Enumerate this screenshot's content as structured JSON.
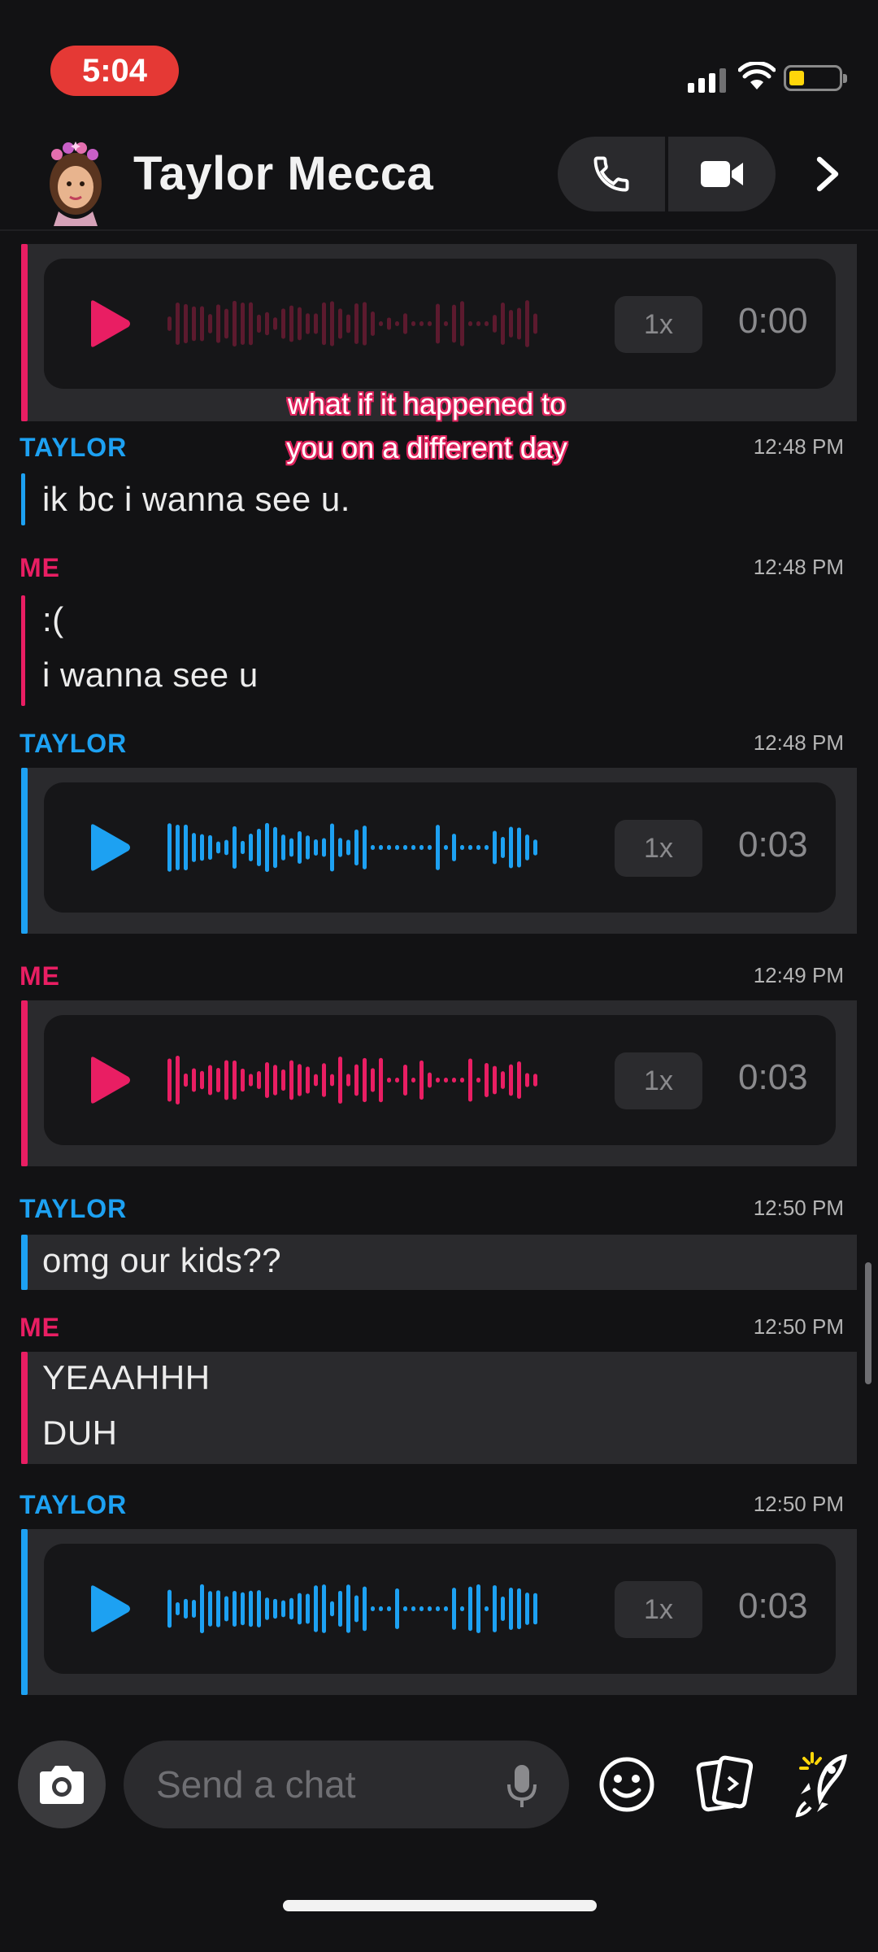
{
  "status_bar": {
    "time": "5:04"
  },
  "header": {
    "title": "Taylor Mecca",
    "avatar_icon": "bitmoji-avatar-icon",
    "call_icon": "phone-icon",
    "video_icon": "video-camera-icon",
    "forward_icon": "chevron-right-icon"
  },
  "colors": {
    "me": "#e91e63",
    "taylor": "#1da1f2",
    "background": "#121214"
  },
  "caption": {
    "line1": "what if it happened to",
    "line2": "you on a different day"
  },
  "messages": [
    {
      "type": "audio",
      "from": "ME",
      "speed": "1x",
      "duration": "0:00",
      "note": "partially scrolled off top"
    },
    {
      "type": "text",
      "from": "TAYLOR",
      "time": "12:48 PM",
      "lines": [
        "ik bc i wanna see u."
      ]
    },
    {
      "type": "text",
      "from": "ME",
      "time": "12:48 PM",
      "lines": [
        ":(",
        "i wanna see u"
      ]
    },
    {
      "type": "audio",
      "from": "TAYLOR",
      "time": "12:48 PM",
      "speed": "1x",
      "duration": "0:03"
    },
    {
      "type": "audio",
      "from": "ME",
      "time": "12:49 PM",
      "speed": "1x",
      "duration": "0:03"
    },
    {
      "type": "text",
      "from": "TAYLOR",
      "time": "12:50 PM",
      "lines": [
        "omg our kids??"
      ]
    },
    {
      "type": "text",
      "from": "ME",
      "time": "12:50 PM",
      "lines": [
        "YEAAHHH",
        "DUH"
      ]
    },
    {
      "type": "audio",
      "from": "TAYLOR",
      "time": "12:50 PM",
      "speed": "1x",
      "duration": "0:03"
    }
  ],
  "composer": {
    "placeholder": "Send a chat",
    "camera_icon": "camera-icon",
    "mic_icon": "microphone-icon",
    "emoji_icon": "smiley-icon",
    "stickers_icon": "cards-icon",
    "games_icon": "rocket-icon"
  }
}
